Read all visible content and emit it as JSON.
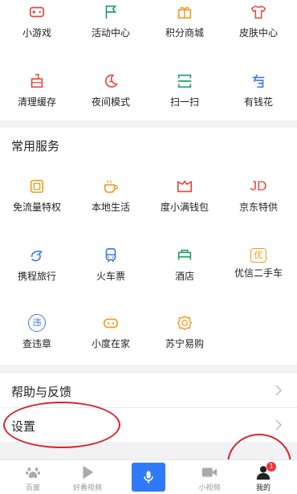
{
  "top_grid": {
    "row1": [
      {
        "label": "小游戏",
        "icon": "gamepad-icon"
      },
      {
        "label": "活动中心",
        "icon": "flag-icon"
      },
      {
        "label": "积分商城",
        "icon": "gift-icon"
      },
      {
        "label": "皮肤中心",
        "icon": "tshirt-icon"
      }
    ],
    "row2": [
      {
        "label": "清理缓存",
        "icon": "broom-icon"
      },
      {
        "label": "夜间模式",
        "icon": "moon-icon"
      },
      {
        "label": "扫一扫",
        "icon": "scan-icon"
      },
      {
        "label": "有钱花",
        "icon": "money-icon"
      }
    ]
  },
  "services": {
    "title": "常用服务",
    "row1": [
      {
        "label": "免流量特权",
        "icon": "data-card-icon"
      },
      {
        "label": "本地生活",
        "icon": "coffee-icon"
      },
      {
        "label": "度小满钱包",
        "icon": "wallet-icon"
      },
      {
        "label": "京东特供",
        "icon": "jd-icon",
        "glyph": "JD"
      }
    ],
    "row2": [
      {
        "label": "携程旅行",
        "icon": "dolphin-icon"
      },
      {
        "label": "火车票",
        "icon": "train-icon"
      },
      {
        "label": "酒店",
        "icon": "bed-icon"
      },
      {
        "label": "优信二手车",
        "icon": "car-icon",
        "glyph": "优"
      }
    ],
    "row3": [
      {
        "label": "查违章",
        "icon": "violation-icon",
        "glyph": "违"
      },
      {
        "label": "小度在家",
        "icon": "robot-icon"
      },
      {
        "label": "苏宁易购",
        "icon": "lion-icon"
      }
    ]
  },
  "list": {
    "help": "帮助与反馈",
    "settings": "设置"
  },
  "tabbar": {
    "items": [
      {
        "label": "百度",
        "icon": "paw-icon"
      },
      {
        "label": "好看视频",
        "icon": "play-icon"
      },
      {
        "label": "",
        "icon": "microphone-icon"
      },
      {
        "label": "小视频",
        "icon": "video-camera-icon"
      },
      {
        "label": "我的",
        "icon": "person-icon"
      }
    ],
    "badge": "1"
  },
  "colors": {
    "red": "#e8453c",
    "green": "#1aa260",
    "orange": "#f29c1f",
    "blue": "#3d7be0",
    "accent_blue": "#2f7af8",
    "annotation": "#d9232b"
  }
}
